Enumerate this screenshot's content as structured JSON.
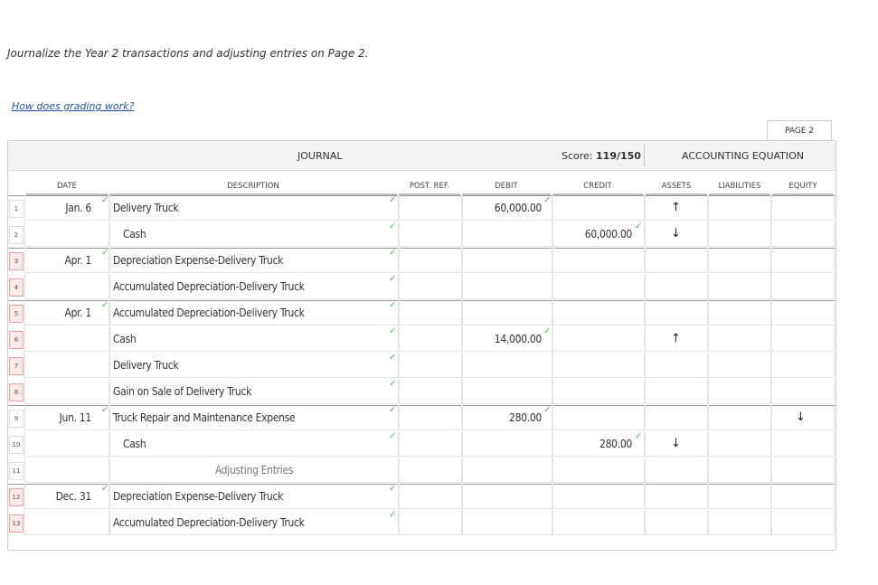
{
  "instruction": "Journalize the Year 2 transactions and adjusting entries on Page 2.",
  "help_link": "How does grading work?",
  "page_tab": "PAGE 2",
  "header": {
    "journal": "JOURNAL",
    "score_label": "Score:",
    "score_value": "119/150",
    "accounting_equation": "ACCOUNTING EQUATION"
  },
  "columns": {
    "date": "DATE",
    "description": "DESCRIPTION",
    "post_ref": "POST. REF.",
    "debit": "DEBIT",
    "credit": "CREDIT",
    "assets": "ASSETS",
    "liabilities": "LIABILITIES",
    "equity": "EQUITY"
  },
  "rows": [
    {
      "num": "1",
      "flag": false,
      "date": "Jan. 6",
      "desc": "Delivery Truck",
      "indent": false,
      "debit": "60,000.00",
      "credit": "",
      "assets": "↑",
      "liabilities": "",
      "equity": ""
    },
    {
      "num": "2",
      "flag": false,
      "date": "",
      "desc": "Cash",
      "indent": true,
      "debit": "",
      "credit": "60,000.00",
      "assets": "↓",
      "liabilities": "",
      "equity": ""
    },
    {
      "num": "3",
      "flag": true,
      "date": "Apr. 1",
      "desc": "Depreciation Expense-Delivery Truck",
      "indent": false,
      "debit": "",
      "credit": "",
      "assets": "",
      "liabilities": "",
      "equity": ""
    },
    {
      "num": "4",
      "flag": true,
      "date": "",
      "desc": "Accumulated Depreciation-Delivery Truck",
      "indent": false,
      "debit": "",
      "credit": "",
      "assets": "",
      "liabilities": "",
      "equity": ""
    },
    {
      "num": "5",
      "flag": true,
      "date": "Apr. 1",
      "desc": "Accumulated Depreciation-Delivery Truck",
      "indent": false,
      "debit": "",
      "credit": "",
      "assets": "",
      "liabilities": "",
      "equity": ""
    },
    {
      "num": "6",
      "flag": true,
      "date": "",
      "desc": "Cash",
      "indent": false,
      "debit": "14,000.00",
      "credit": "",
      "assets": "↑",
      "liabilities": "",
      "equity": ""
    },
    {
      "num": "7",
      "flag": true,
      "date": "",
      "desc": "Delivery Truck",
      "indent": false,
      "debit": "",
      "credit": "",
      "assets": "",
      "liabilities": "",
      "equity": ""
    },
    {
      "num": "8",
      "flag": true,
      "date": "",
      "desc": "Gain on Sale of Delivery Truck",
      "indent": false,
      "debit": "",
      "credit": "",
      "assets": "",
      "liabilities": "",
      "equity": ""
    },
    {
      "num": "9",
      "flag": false,
      "date": "Jun. 11",
      "desc": "Truck Repair and Maintenance Expense",
      "indent": false,
      "debit": "280.00",
      "credit": "",
      "assets": "",
      "liabilities": "",
      "equity": "↓"
    },
    {
      "num": "10",
      "flag": false,
      "date": "",
      "desc": "Cash",
      "indent": true,
      "debit": "",
      "credit": "280.00",
      "assets": "↓",
      "liabilities": "",
      "equity": ""
    },
    {
      "num": "11",
      "flag": false,
      "date": "",
      "desc": "Adjusting Entries",
      "indent": false,
      "center": true,
      "debit": "",
      "credit": "",
      "assets": "",
      "liabilities": "",
      "equity": ""
    },
    {
      "num": "12",
      "flag": true,
      "date": "Dec. 31",
      "desc": "Depreciation Expense-Delivery Truck",
      "indent": false,
      "debit": "",
      "credit": "",
      "assets": "",
      "liabilities": "",
      "equity": ""
    },
    {
      "num": "13",
      "flag": true,
      "date": "",
      "desc": "Accumulated Depreciation-Delivery Truck",
      "indent": false,
      "debit": "",
      "credit": "",
      "assets": "",
      "liabilities": "",
      "equity": ""
    }
  ],
  "colors": {
    "check": "#5cb85c",
    "link": "#2255aa",
    "flag_bg": "#fbeaea"
  },
  "icons": {
    "check": "check-icon",
    "up": "arrow-up-icon",
    "down": "arrow-down-icon"
  }
}
